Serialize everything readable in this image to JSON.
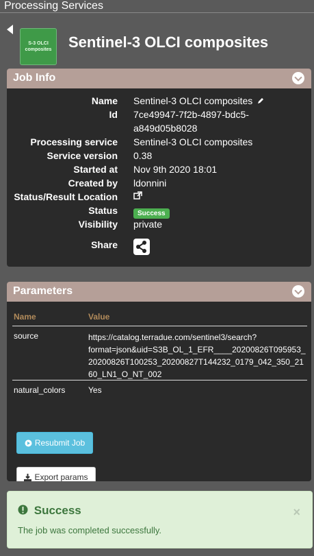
{
  "app": {
    "title": "Processing Services"
  },
  "header": {
    "logo_text_line1": "S-3 OLCI",
    "logo_text_line2": "composites",
    "title": "Sentinel-3 OLCI composites"
  },
  "job_info": {
    "heading": "Job Info",
    "rows": {
      "name_label": "Name",
      "name_value": "Sentinel-3 OLCI composites",
      "id_label": "Id",
      "id_value_line1": "7ce49947-7f2b-4897-bdc5-",
      "id_value_line2": "a849d05b8028",
      "service_label": "Processing service",
      "service_value": "Sentinel-3 OLCI composites",
      "version_label": "Service version",
      "version_value": "0.38",
      "started_label": "Started at",
      "started_value": "Nov 9th 2020 18:01",
      "created_label": "Created by",
      "created_value": "ldonnini",
      "location_label": "Status/Result Location",
      "status_label": "Status",
      "status_value": "Success",
      "visibility_label": "Visibility",
      "visibility_value": "private",
      "share_label": "Share"
    }
  },
  "parameters": {
    "heading": "Parameters",
    "col_name": "Name",
    "col_value": "Value",
    "rows": [
      {
        "name": "source",
        "value_lines": [
          "https://catalog.terradue.com/sentinel3/search?",
          "format=json&uid=S3B_OL_1_EFR____20200826T095953_",
          "20200826T100253_20200827T144232_0179_042_350_21",
          "60_LN1_O_NT_002"
        ]
      },
      {
        "name": "natural_colors",
        "value": "Yes"
      }
    ],
    "resubmit_label": "Resubmit Job",
    "export_label": "Export params"
  },
  "alert": {
    "title": "Success",
    "message": "The job was completed successfully.",
    "close": "×"
  },
  "icons": {
    "back": "back-arrow-icon",
    "edit": "pencil-icon",
    "external": "external-link-icon",
    "share": "share-icon",
    "collapse": "chevron-down-icon",
    "play": "play-circle-icon",
    "download": "download-icon",
    "alert": "exclamation-circle-icon"
  },
  "colors": {
    "background": "#5a5a5a",
    "panel_header": "#b59f98",
    "panel_body": "#2a2a2a",
    "success_badge": "#4caf50",
    "resubmit": "#5bc0de",
    "alert_bg": "#dff0d8",
    "alert_text": "#3c763d"
  }
}
